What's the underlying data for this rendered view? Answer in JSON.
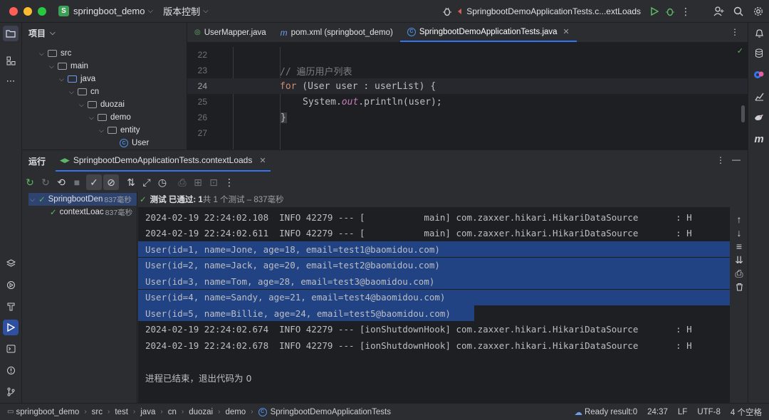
{
  "titlebar": {
    "project_badge": "S",
    "project_name": "springboot_demo",
    "vcs_label": "版本控制",
    "run_config": "SpringbootDemoApplicationTests.c...extLoads"
  },
  "project_panel": {
    "title": "项目",
    "tree": [
      {
        "label": "src",
        "kind": "folder"
      },
      {
        "label": "main",
        "kind": "folder"
      },
      {
        "label": "java",
        "kind": "folder-blue"
      },
      {
        "label": "cn",
        "kind": "folder"
      },
      {
        "label": "duozai",
        "kind": "folder"
      },
      {
        "label": "demo",
        "kind": "folder"
      },
      {
        "label": "entity",
        "kind": "folder"
      },
      {
        "label": "User",
        "kind": "class"
      }
    ]
  },
  "editor": {
    "tabs": [
      {
        "label": "UserMapper.java",
        "icon": "interface-icon"
      },
      {
        "label": "pom.xml (springboot_demo)",
        "icon": "maven-icon"
      },
      {
        "label": "SpringbootDemoApplicationTests.java",
        "icon": "class-icon",
        "active": true
      }
    ],
    "lines": [
      {
        "num": "22",
        "text": ""
      },
      {
        "num": "23",
        "text": "// 遍历用户列表"
      },
      {
        "num": "24",
        "kw": "for",
        "text": " (User user : userList) {"
      },
      {
        "num": "25",
        "pre": "System.",
        "it": "out",
        "post": ".println(user);"
      },
      {
        "num": "26",
        "text": "}"
      },
      {
        "num": "27",
        "text": ""
      }
    ]
  },
  "run_panel": {
    "title": "运行",
    "tab_label": "SpringbootDemoApplicationTests.contextLoads",
    "summary_prefix": "测试 已通过: 1",
    "summary_suffix": "共 1 个测试 – 837毫秒",
    "tree": [
      {
        "label": "SpringbootDen",
        "time": "837毫秒"
      },
      {
        "label": "contextLoac",
        "time": "837毫秒"
      }
    ],
    "console_lines": [
      {
        "text": "2024-02-19 22:24:02.108  INFO 42279 --- [           main] com.zaxxer.hikari.HikariDataSource       : H",
        "selected": false
      },
      {
        "text": "2024-02-19 22:24:02.611  INFO 42279 --- [           main] com.zaxxer.hikari.HikariDataSource       : H",
        "selected": false
      },
      {
        "text": "User(id=1, name=Jone, age=18, email=test1@baomidou.com)",
        "selected": true
      },
      {
        "text": "User(id=2, name=Jack, age=20, email=test2@baomidou.com)",
        "selected": true
      },
      {
        "text": "User(id=3, name=Tom, age=28, email=test3@baomidou.com)",
        "selected": true
      },
      {
        "text": "User(id=4, name=Sandy, age=21, email=test4@baomidou.com)",
        "selected": true
      },
      {
        "text": "User(id=5, name=Billie, age=24, email=test5@baomidou.com)",
        "selected": true
      },
      {
        "text": "2024-02-19 22:24:02.674  INFO 42279 --- [ionShutdownHook] com.zaxxer.hikari.HikariDataSource       : H",
        "selected": false
      },
      {
        "text": "2024-02-19 22:24:02.678  INFO 42279 --- [ionShutdownHook] com.zaxxer.hikari.HikariDataSource       : H",
        "selected": false
      },
      {
        "text": "",
        "selected": false
      },
      {
        "text": "进程已结束，退出代码为 0",
        "selected": false
      }
    ]
  },
  "statusbar": {
    "breadcrumbs": [
      "springboot_demo",
      "src",
      "test",
      "java",
      "cn",
      "duozai",
      "demo",
      "SpringbootDemoApplicationTests"
    ],
    "ready": "Ready result:0",
    "position": "24:37",
    "line_sep": "LF",
    "encoding": "UTF-8",
    "indent": "4 个空格"
  },
  "colors": {
    "accent": "#3574f0",
    "selection": "#214283",
    "success": "#5fb865"
  }
}
